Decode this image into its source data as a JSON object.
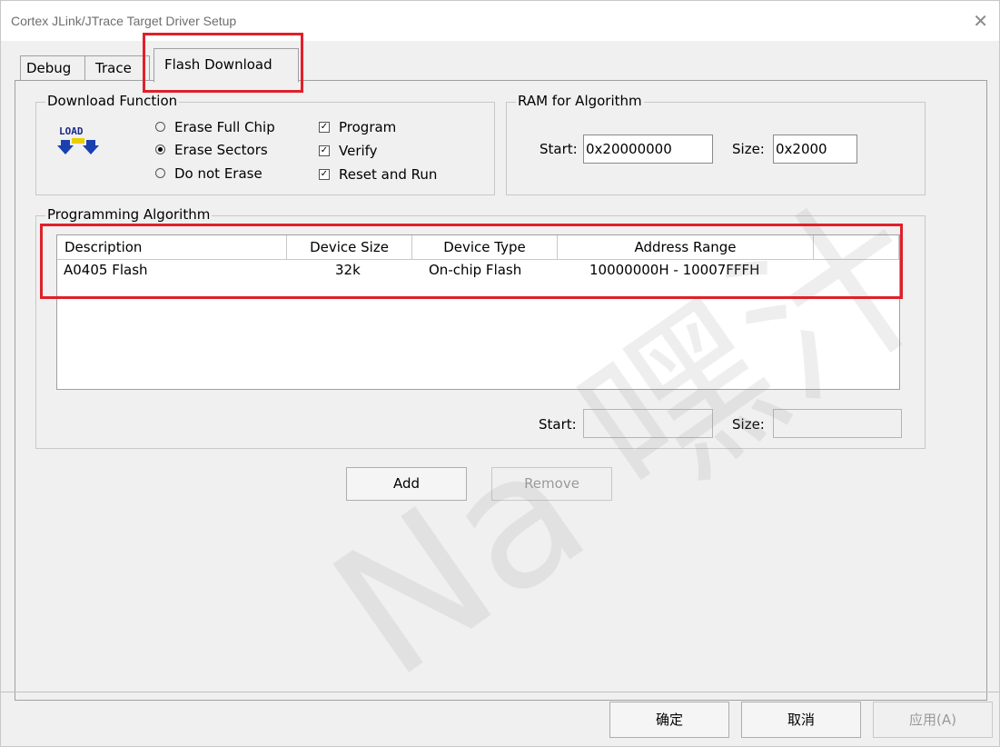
{
  "window": {
    "title": "Cortex JLink/JTrace Target Driver Setup",
    "close_glyph": "✕"
  },
  "tabs": [
    {
      "label": "Debug"
    },
    {
      "label": "Trace"
    },
    {
      "label": "Flash Download",
      "selected": true
    }
  ],
  "download_function": {
    "legend": "Download Function",
    "icon": "load-icon",
    "radios": [
      {
        "label": "Erase Full Chip",
        "checked": false
      },
      {
        "label": "Erase Sectors",
        "checked": true
      },
      {
        "label": "Do not Erase",
        "checked": false
      }
    ],
    "checkboxes": [
      {
        "label": "Program",
        "checked": true
      },
      {
        "label": "Verify",
        "checked": true
      },
      {
        "label": "Reset and Run",
        "checked": true
      }
    ]
  },
  "ram_for_algorithm": {
    "legend": "RAM for Algorithm",
    "start_label": "Start:",
    "start_value": "0x20000000",
    "size_label": "Size:",
    "size_value": "0x2000"
  },
  "programming_algorithm": {
    "legend": "Programming Algorithm",
    "columns": [
      "Description",
      "Device Size",
      "Device Type",
      "Address Range"
    ],
    "rows": [
      {
        "description": "A0405 Flash",
        "device_size": "32k",
        "device_type": "On-chip Flash",
        "address_range": "10000000H - 10007FFFH"
      }
    ],
    "start_label": "Start:",
    "start_value": "",
    "size_label": "Size:",
    "size_value": ""
  },
  "buttons": {
    "add": "Add",
    "remove": "Remove",
    "ok": "确定",
    "cancel": "取消",
    "apply": "应用(A)"
  },
  "watermark": "Na 嘿汁",
  "colors": {
    "highlight": "#e0202a",
    "background": "#f0f0f0"
  }
}
